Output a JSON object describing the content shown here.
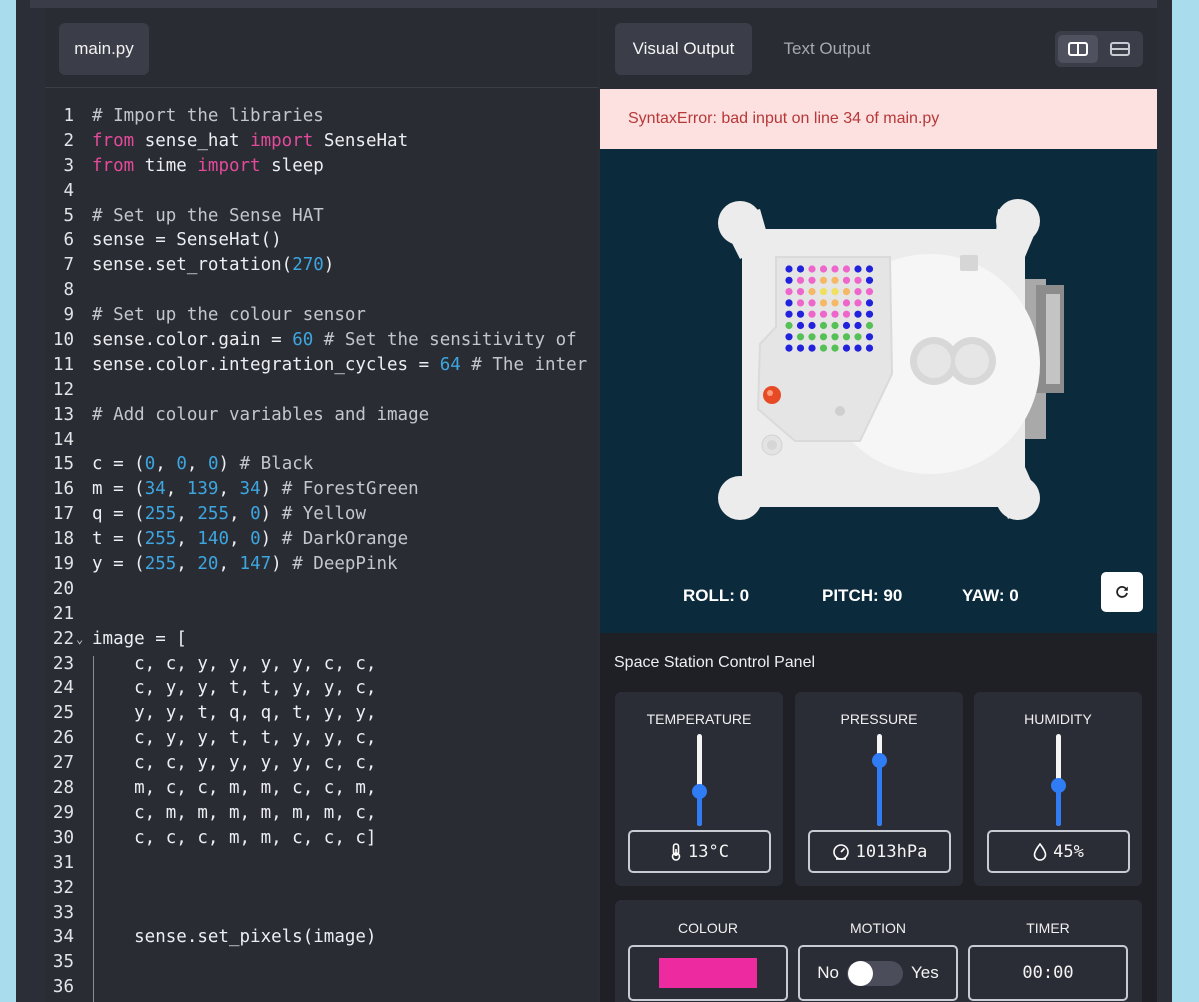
{
  "editor": {
    "file_tab": "main.py",
    "lines": [
      [
        [
          "cm",
          "# Import the libraries"
        ]
      ],
      [
        [
          "kw",
          "from"
        ],
        [
          "t",
          " sense_hat "
        ],
        [
          "kw",
          "import"
        ],
        [
          "t",
          " SenseHat"
        ]
      ],
      [
        [
          "kw",
          "from"
        ],
        [
          "t",
          " time "
        ],
        [
          "kw",
          "import"
        ],
        [
          "t",
          " sleep"
        ]
      ],
      [],
      [
        [
          "cm",
          "# Set up the Sense HAT"
        ]
      ],
      [
        [
          "t",
          "sense = SenseHat()"
        ]
      ],
      [
        [
          "t",
          "sense.set_rotation("
        ],
        [
          "num",
          "270"
        ],
        [
          "t",
          ")"
        ]
      ],
      [],
      [
        [
          "cm",
          "# Set up the colour sensor"
        ]
      ],
      [
        [
          "t",
          "sense.color.gain = "
        ],
        [
          "num",
          "60"
        ],
        [
          "cm",
          " # Set the sensitivity of"
        ]
      ],
      [
        [
          "t",
          "sense.color.integration_cycles = "
        ],
        [
          "num",
          "64"
        ],
        [
          "cm",
          " # The inter"
        ]
      ],
      [],
      [
        [
          "cm",
          "# Add colour variables and image"
        ]
      ],
      [],
      [
        [
          "t",
          "c = ("
        ],
        [
          "num",
          "0"
        ],
        [
          "t",
          ", "
        ],
        [
          "num",
          "0"
        ],
        [
          "t",
          ", "
        ],
        [
          "num",
          "0"
        ],
        [
          "t",
          ") "
        ],
        [
          "cm",
          "# Black"
        ]
      ],
      [
        [
          "t",
          "m = ("
        ],
        [
          "num",
          "34"
        ],
        [
          "t",
          ", "
        ],
        [
          "num",
          "139"
        ],
        [
          "t",
          ", "
        ],
        [
          "num",
          "34"
        ],
        [
          "t",
          ") "
        ],
        [
          "cm",
          "# ForestGreen"
        ]
      ],
      [
        [
          "t",
          "q = ("
        ],
        [
          "num",
          "255"
        ],
        [
          "t",
          ", "
        ],
        [
          "num",
          "255"
        ],
        [
          "t",
          ", "
        ],
        [
          "num",
          "0"
        ],
        [
          "t",
          ") "
        ],
        [
          "cm",
          "# Yellow"
        ]
      ],
      [
        [
          "t",
          "t = ("
        ],
        [
          "num",
          "255"
        ],
        [
          "t",
          ", "
        ],
        [
          "num",
          "140"
        ],
        [
          "t",
          ", "
        ],
        [
          "num",
          "0"
        ],
        [
          "t",
          ") "
        ],
        [
          "cm",
          "# DarkOrange"
        ]
      ],
      [
        [
          "t",
          "y = ("
        ],
        [
          "num",
          "255"
        ],
        [
          "t",
          ", "
        ],
        [
          "num",
          "20"
        ],
        [
          "t",
          ", "
        ],
        [
          "num",
          "147"
        ],
        [
          "t",
          ") "
        ],
        [
          "cm",
          "# DeepPink"
        ]
      ],
      [],
      [],
      [
        [
          "t",
          "image = ["
        ]
      ],
      [
        [
          "t",
          "    c, c, y, y, y, y, c, c,"
        ]
      ],
      [
        [
          "t",
          "    c, y, y, t, t, y, y, c,"
        ]
      ],
      [
        [
          "t",
          "    y, y, t, q, q, t, y, y,"
        ]
      ],
      [
        [
          "t",
          "    c, y, y, t, t, y, y, c,"
        ]
      ],
      [
        [
          "t",
          "    c, c, y, y, y, y, c, c,"
        ]
      ],
      [
        [
          "t",
          "    m, c, c, m, m, c, c, m,"
        ]
      ],
      [
        [
          "t",
          "    c, m, m, m, m, m, m, c,"
        ]
      ],
      [
        [
          "t",
          "    c, c, c, m, m, c, c, c]"
        ]
      ],
      [],
      [],
      [],
      [
        [
          "t",
          "    sense.set_pixels(image)"
        ]
      ],
      [],
      []
    ],
    "fold_line": 22
  },
  "output": {
    "tab_visual": "Visual Output",
    "tab_text": "Text Output",
    "error": "SyntaxError: bad input on line 34 of main.py",
    "roll": "ROLL: 0",
    "pitch": "PITCH: 90",
    "yaw": "YAW: 0",
    "led_matrix": [
      [
        "b",
        "b",
        "p",
        "p",
        "p",
        "p",
        "b",
        "b"
      ],
      [
        "b",
        "p",
        "p",
        "o",
        "o",
        "p",
        "p",
        "b"
      ],
      [
        "p",
        "p",
        "o",
        "q",
        "q",
        "o",
        "p",
        "p"
      ],
      [
        "b",
        "p",
        "p",
        "o",
        "o",
        "p",
        "p",
        "b"
      ],
      [
        "b",
        "b",
        "p",
        "p",
        "p",
        "p",
        "b",
        "b"
      ],
      [
        "g",
        "b",
        "b",
        "g",
        "g",
        "b",
        "b",
        "g"
      ],
      [
        "b",
        "g",
        "g",
        "g",
        "g",
        "g",
        "g",
        "b"
      ],
      [
        "b",
        "b",
        "b",
        "g",
        "g",
        "b",
        "b",
        "b"
      ]
    ],
    "led_colors": {
      "b": "#2222dd",
      "p": "#ee66cc",
      "o": "#f5b866",
      "q": "#f0e060",
      "g": "#55c055"
    }
  },
  "control_panel": {
    "title": "Space Station Control Panel",
    "temperature": {
      "label": "TEMPERATURE",
      "value": "13°C",
      "level": 0.38
    },
    "pressure": {
      "label": "PRESSURE",
      "value": "1013hPa",
      "level": 0.72
    },
    "humidity": {
      "label": "HUMIDITY",
      "value": "45%",
      "level": 0.45
    },
    "colour": {
      "label": "COLOUR",
      "swatch": "#ee2aa0"
    },
    "motion": {
      "label": "MOTION",
      "no": "No",
      "yes": "Yes"
    },
    "timer": {
      "label": "TIMER",
      "value": "00:00"
    }
  },
  "colors": {
    "keyword": "#e44a9a",
    "number": "#3da6e0",
    "accent": "#2f7cf5",
    "error_bg": "#fde0e0",
    "stage_bg": "#0b2a3c"
  }
}
